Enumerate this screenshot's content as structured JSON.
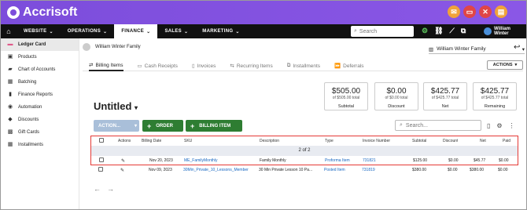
{
  "brand": {
    "name": "Accrisoft"
  },
  "nav": {
    "items": [
      {
        "label": "WEBSITE"
      },
      {
        "label": "OPERATIONS"
      },
      {
        "label": "FINANCE"
      },
      {
        "label": "SALES"
      },
      {
        "label": "MARKETING"
      }
    ],
    "search_placeholder": "Search",
    "user": "William Winter"
  },
  "sidebar": {
    "items": [
      {
        "label": "Ledger Card"
      },
      {
        "label": "Products"
      },
      {
        "label": "Chart of Accounts"
      },
      {
        "label": "Batching"
      },
      {
        "label": "Finance Reports"
      },
      {
        "label": "Automation"
      },
      {
        "label": "Discounts"
      },
      {
        "label": "Gift Cards"
      },
      {
        "label": "Installments"
      }
    ]
  },
  "client": {
    "name": "William Winter Family",
    "selected": "William Winter Family"
  },
  "tabs": [
    {
      "label": "Billing Items"
    },
    {
      "label": "Cash Receipts"
    },
    {
      "label": "Invoices"
    },
    {
      "label": "Recurring Items"
    },
    {
      "label": "Installments"
    },
    {
      "label": "Deferrals"
    }
  ],
  "actions_button": "ACTIONS",
  "summary_cards": [
    {
      "value": "$505.00",
      "sub": "of $505.00 total",
      "label": "Subtotal"
    },
    {
      "value": "$0.00",
      "sub": "of $0.00 total",
      "label": "Discount"
    },
    {
      "value": "$425.77",
      "sub": "of $425.77 total",
      "label": "Net"
    },
    {
      "value": "$425.77",
      "sub": "of $425.77 total",
      "label": "Remaining"
    }
  ],
  "list": {
    "title": "Untitled",
    "action_label": "ACTION...",
    "order_label": "ORDER",
    "billing_item_label": "BILLING ITEM",
    "search_placeholder": "Search..."
  },
  "table": {
    "columns": [
      "Actions",
      "Billing Date",
      "SKU",
      "Description",
      "Type",
      "Invoice Number",
      "Subtotal",
      "Discount",
      "Net",
      "Paid"
    ],
    "pager": "2 of 2",
    "rows": [
      {
        "date": "Nov 20, 2023",
        "sku": "ME_FamilyMonthly",
        "description": "Family Monthly",
        "type": "Proforma Item",
        "invoice": "731821",
        "subtotal": "$125.00",
        "discount": "$0.00",
        "net": "$45.77",
        "paid": "$0.00"
      },
      {
        "date": "Nov 09, 2023",
        "sku": "30Min_Private_10_Lessons_Member",
        "description": "30 Min Private Lesson 10 Pa...",
        "type": "Posted Item",
        "invoice": "731819",
        "subtotal": "$380.00",
        "discount": "$0.00",
        "net": "$380.00",
        "paid": "$0.00"
      }
    ]
  }
}
